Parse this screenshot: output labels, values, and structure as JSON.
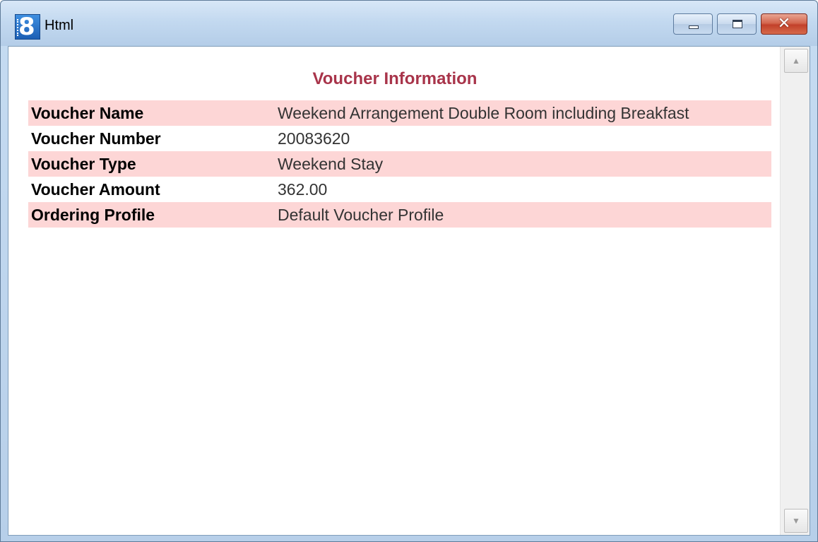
{
  "window": {
    "title": "Html",
    "app_icon_glyph": "8",
    "controls": {
      "minimize_icon": "minimize-icon",
      "maximize_icon": "maximize-icon",
      "close_glyph": "✕"
    }
  },
  "scrollbar": {
    "up_arrow": "▲",
    "down_arrow": "▼"
  },
  "page": {
    "title": "Voucher Information",
    "title_color": "#a8344a",
    "stripe_color": "#fdd6d6",
    "rows": [
      {
        "label": "Voucher Name",
        "value": "Weekend Arrangement Double Room including Breakfast"
      },
      {
        "label": "Voucher Number",
        "value": "20083620"
      },
      {
        "label": "Voucher Type",
        "value": "Weekend Stay"
      },
      {
        "label": "Voucher Amount",
        "value": "362.00"
      },
      {
        "label": "Ordering Profile",
        "value": "Default Voucher Profile"
      }
    ]
  }
}
